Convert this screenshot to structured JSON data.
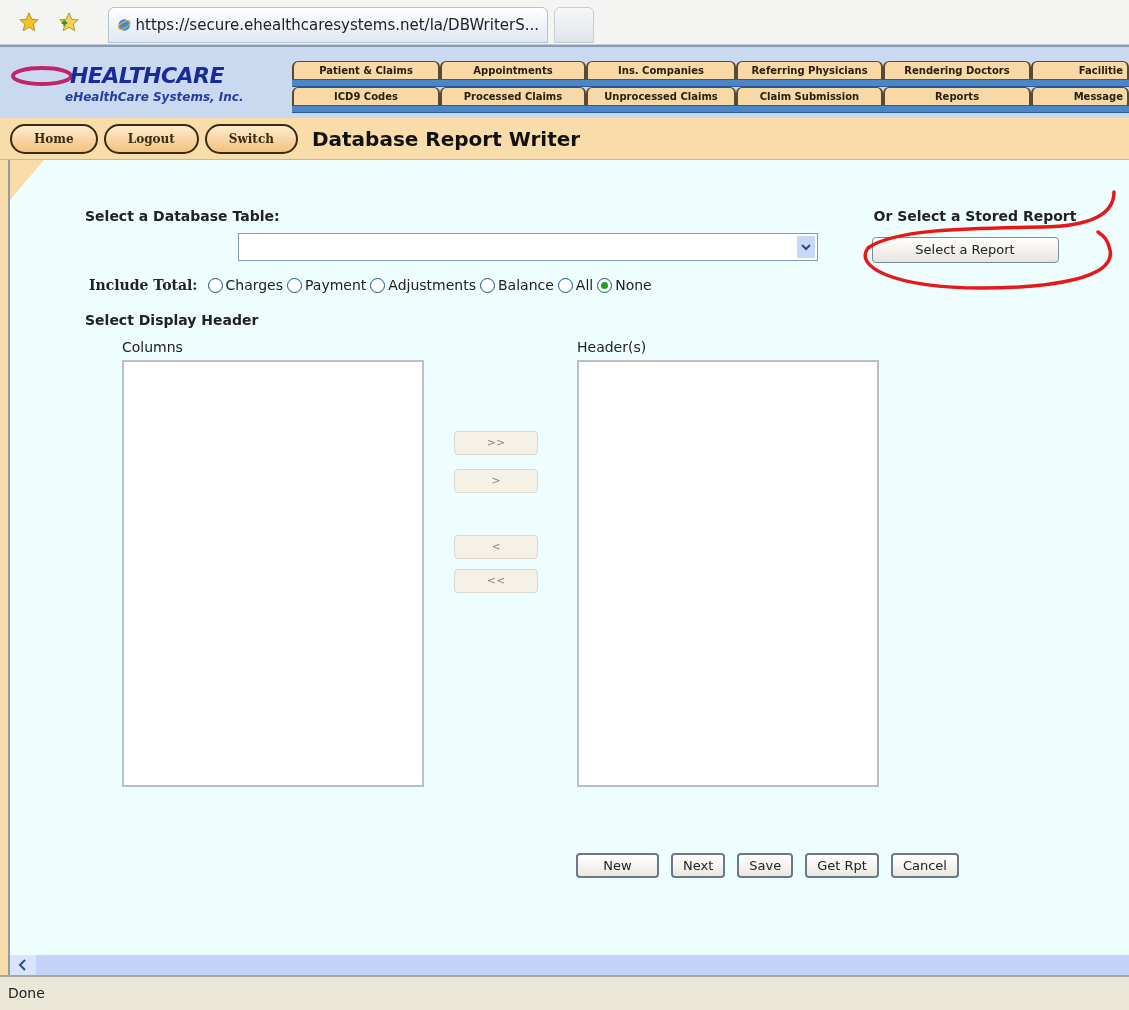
{
  "browser": {
    "tab_title": "https://secure.ehealthcaresystems.net/la/DBWriterS..."
  },
  "logo": {
    "mark": "HEALTHCARE",
    "subtitle": "eHealthCare Systems, Inc."
  },
  "nav_tabs": [
    [
      "Patient & Claims",
      "Appointments",
      "Ins. Companies",
      "Referring Physicians",
      "Rendering Doctors",
      "Facilitie"
    ],
    [
      "ICD9 Codes",
      "Processed Claims",
      "Unprocessed Claims",
      "Claim Submission",
      "Reports",
      "Message"
    ]
  ],
  "nav_buttons": [
    "Home",
    "Logout",
    "Switch"
  ],
  "page_title": "Database Report Writer",
  "form": {
    "table_label": "Select a Database Table:",
    "stored_report_label": "Or Select a Stored Report",
    "stored_report_button": "Select a Report",
    "include_total": {
      "label": "Include Total:",
      "options": [
        {
          "label": "Charges",
          "selected": false
        },
        {
          "label": "Payment",
          "selected": false
        },
        {
          "label": "Adjustments",
          "selected": false
        },
        {
          "label": "Balance",
          "selected": false
        },
        {
          "label": "All",
          "selected": false
        },
        {
          "label": "None",
          "selected": true
        }
      ]
    },
    "display_header_label": "Select Display Header",
    "columns_label": "Columns",
    "headers_label": "Header(s)",
    "move_buttons": [
      {
        "label": ">>",
        "disabled": true
      },
      {
        "label": ">",
        "disabled": true
      },
      {
        "label": "<",
        "disabled": true
      },
      {
        "label": "<<",
        "disabled": true
      }
    ],
    "actions": [
      "New",
      "Next",
      "Save",
      "Get Rpt",
      "Cancel"
    ]
  },
  "status_bar": "Done"
}
